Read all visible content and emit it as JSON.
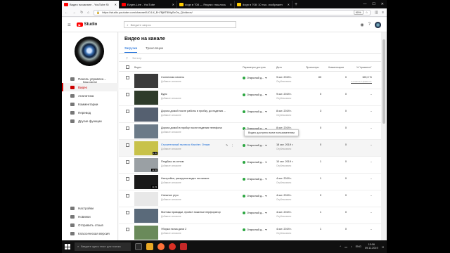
{
  "browser": {
    "tabs": [
      {
        "label": "Видео на канале - YouTube St",
        "active": true,
        "fav": "yt"
      },
      {
        "label": "Evgen-Live - YouTube",
        "active": false,
        "fav": "yt"
      },
      {
        "label": "dogn в 708 — Яндекс: нашлось",
        "active": false,
        "fav": "ya"
      },
      {
        "label": "dogn в 708: 10 тыс. изображен",
        "active": false,
        "fav": "ya"
      }
    ],
    "url": "https://studio.youtube.com/channel/UC4-lf_En7BjftT8MgSxOs_Q/videos/",
    "zoom": "90%"
  },
  "studio": {
    "logo_text": "Studio",
    "search_placeholder": "Введите запрос"
  },
  "sidebar": {
    "channel_name": "Ваш канал",
    "channel_sub": "Evgen-Live",
    "items": [
      {
        "label": "Панель управлен..."
      },
      {
        "label": "Видео"
      },
      {
        "label": "Аналитика"
      },
      {
        "label": "Комментарии"
      },
      {
        "label": "Перевод"
      },
      {
        "label": "Другие функции"
      }
    ],
    "bottom_items": [
      {
        "label": "Настройки"
      },
      {
        "label": "Новинки"
      },
      {
        "label": "Отправить отзыв"
      },
      {
        "label": "Классическая версия"
      }
    ]
  },
  "main": {
    "title": "Видео на канале",
    "tabs": [
      "Загрузки",
      "Трансляции"
    ],
    "filter_placeholder": "Фильтр",
    "columns": {
      "video": "Видео",
      "visibility": "Параметры доступа",
      "date": "Дата",
      "views": "Просмотры",
      "comments": "Комментарии",
      "likes": "% \"нравится\""
    },
    "rows": [
      {
        "title": "Солнечная панель",
        "desc": "Добавьте описание",
        "duration": "",
        "visibility": "Открытый д...",
        "date": "9 окт. 2019 г.",
        "date_sub": "Опубликовано",
        "views": "80",
        "comments": "0",
        "likes": "100,0 %",
        "likes_sub": "1 отметка \"Нравится\"",
        "like_fraction": 1.0,
        "thumb": "#3a3a3a",
        "link": false
      },
      {
        "title": "Буря",
        "desc": "Добавьте описание",
        "duration": "",
        "visibility": "Открытый д...",
        "date": "9 окт. 2019 г.",
        "date_sub": "Опубликовано",
        "views": "0",
        "comments": "0",
        "likes": "–",
        "likes_sub": "",
        "thumb": "#2e3b2a",
        "link": false
      },
      {
        "title": "Дорога домой после работы в пробку, до падения ...",
        "desc": "Добавьте описание",
        "duration": "",
        "visibility": "Открытый д...",
        "date": "8 окт. 2019 г.",
        "date_sub": "Опубликовано",
        "views": "3",
        "comments": "0",
        "likes": "–",
        "likes_sub": "",
        "thumb": "#556070",
        "link": false
      },
      {
        "title": "Дорога домой в пробку после падения телефона",
        "desc": "Добавьте описание",
        "duration": "",
        "visibility": "Открытый д...",
        "date": "8 окт. 2019 г.",
        "date_sub": "Опубликовано",
        "views": "0",
        "comments": "0",
        "likes": "–",
        "likes_sub": "",
        "thumb": "#6b7a88",
        "link": false
      },
      {
        "title": "Строительный пылесос Karcher. Отзыв",
        "desc": "Добавьте описание",
        "duration": "4:36",
        "visibility": "Открытый д...",
        "date": "18 окт. 2019 г.",
        "date_sub": "Опубликовано",
        "views": "0",
        "comments": "0",
        "likes": "–",
        "likes_sub": "",
        "thumb": "#c8c24a",
        "link": true
      },
      {
        "title": "Пгодбаш за селом",
        "desc": "Добавьте описание",
        "duration": "11:30",
        "visibility": "Открытый д...",
        "date": "10 окт. 2019 г.",
        "date_sub": "Опубликовано",
        "views": "1",
        "comments": "0",
        "likes": "–",
        "likes_sub": "",
        "thumb": "#9aa0a4",
        "link": false
      },
      {
        "title": "Настройка, раскрутка видео на канале",
        "desc": "Добавьте описание",
        "duration": "11:23",
        "visibility": "Открытый д...",
        "date": "4 окт. 2019 г.",
        "date_sub": "Опубликовано",
        "views": "1",
        "comments": "0",
        "likes": "–",
        "likes_sub": "",
        "thumb": "#1a1a1a",
        "link": false
      },
      {
        "title": "Снежное утро",
        "desc": "Добавьте описание",
        "duration": "",
        "visibility": "Открытый д...",
        "date": "4 окт. 2019 г.",
        "date_sub": "Опубликовано",
        "views": "0",
        "comments": "0",
        "likes": "–",
        "likes_sub": "",
        "thumb": "#e8e8e8",
        "link": false
      },
      {
        "title": "Монтаж проводки, провел пожитые перфоратор",
        "desc": "Добавьте описание",
        "duration": "",
        "visibility": "Открытый д...",
        "date": "4 окт. 2019 г.",
        "date_sub": "Опубликовано",
        "views": "1",
        "comments": "0",
        "likes": "–",
        "likes_sub": "",
        "thumb": "#5a6a7a",
        "link": false
      },
      {
        "title": "Уборка на ма дачи 2",
        "desc": "Добавьте описание",
        "duration": "",
        "visibility": "Открытый д...",
        "date": "4 окт. 2019 г.",
        "date_sub": "Опубликовано",
        "views": "1",
        "comments": "0",
        "likes": "–",
        "likes_sub": "",
        "thumb": "#6a8a5a",
        "link": false
      }
    ],
    "tooltip": "Видео доступно всем пользователям"
  },
  "taskbar": {
    "search_placeholder": "Введите здесь текст для поиска",
    "lang": "ENG",
    "time": "15:06",
    "date": "09.11.2019"
  }
}
